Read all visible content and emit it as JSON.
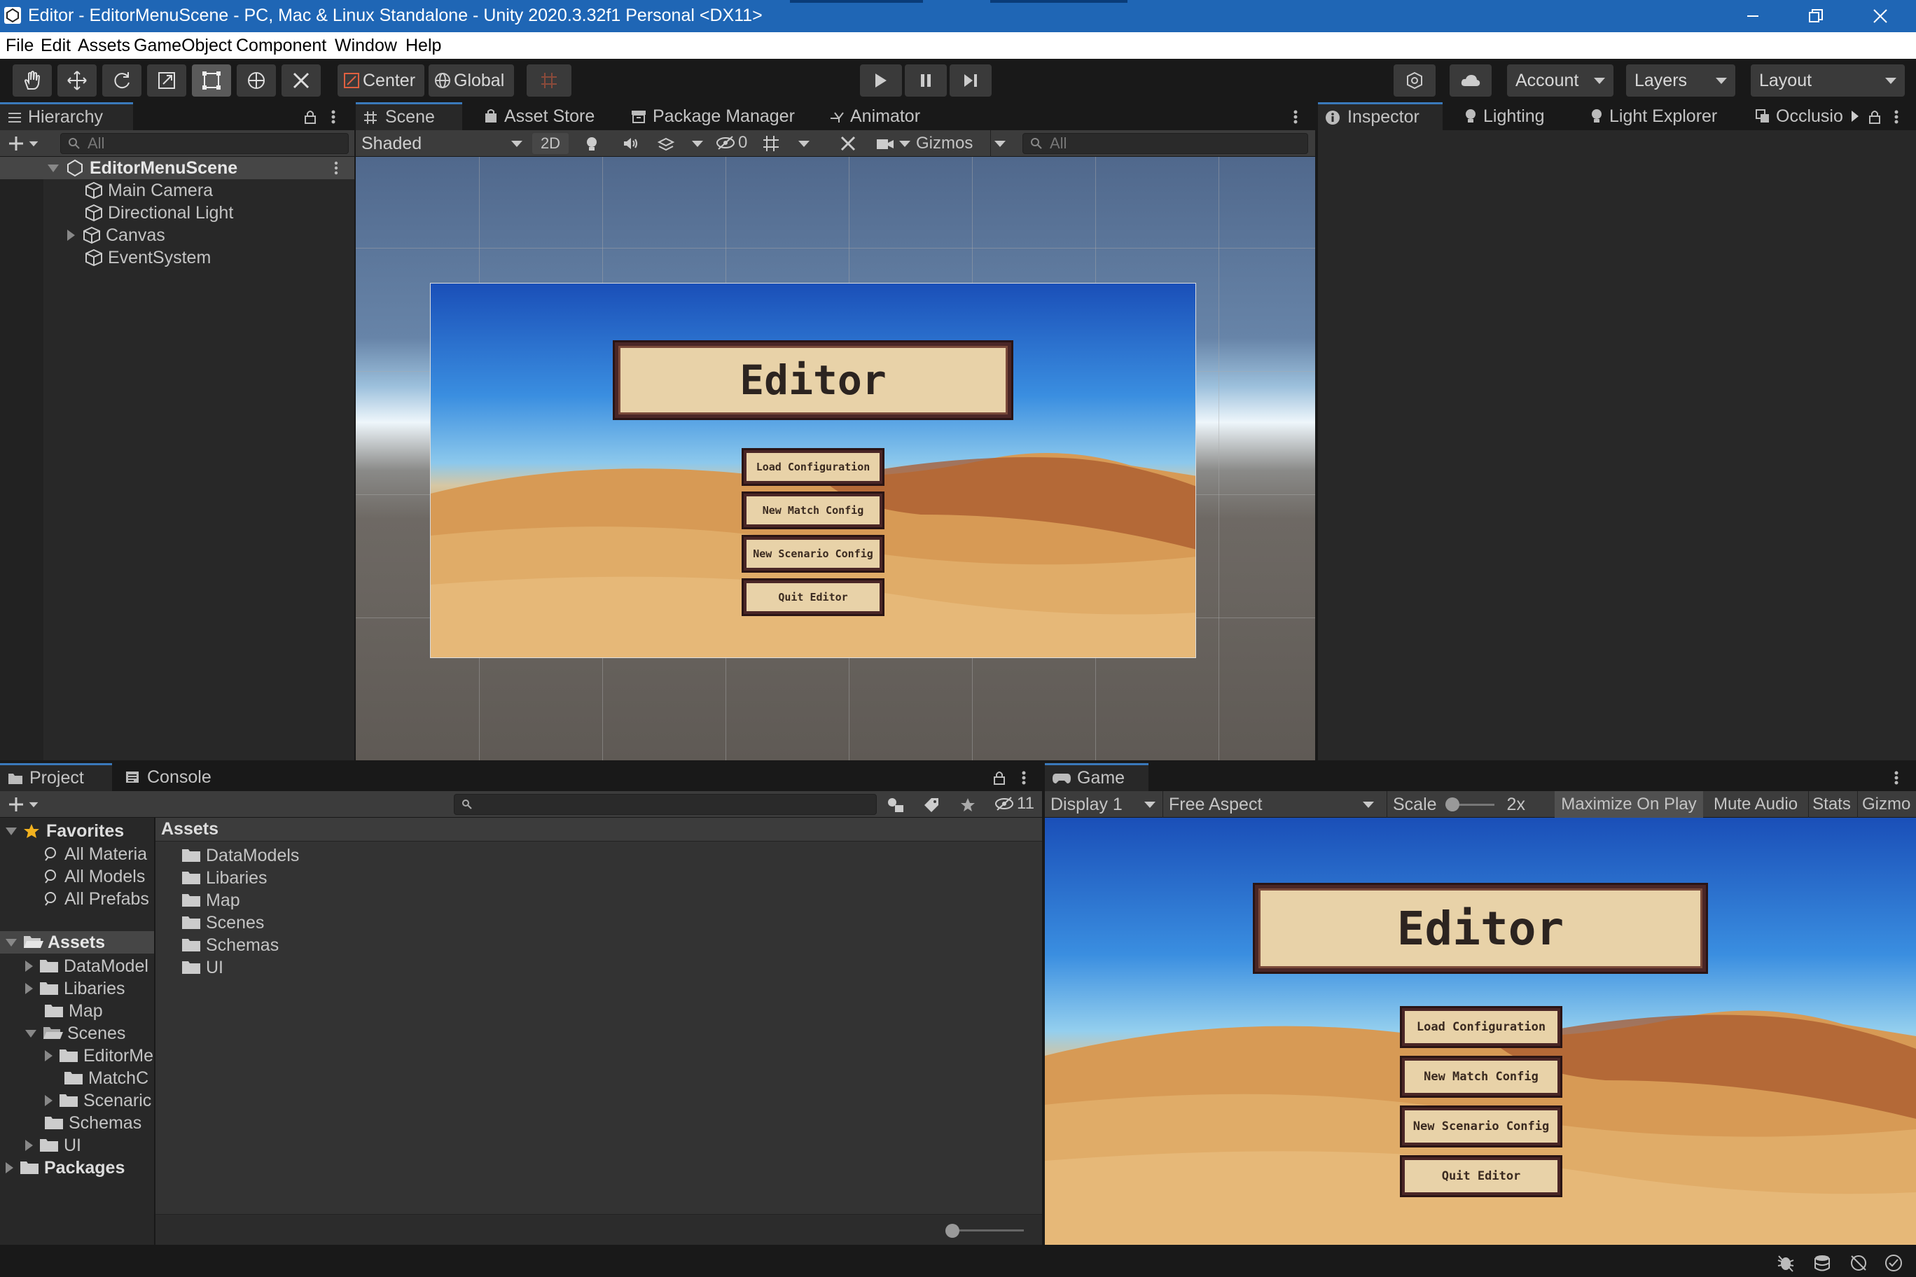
{
  "window": {
    "title": "Editor - EditorMenuScene - PC, Mac & Linux Standalone - Unity 2020.3.32f1 Personal <DX11>"
  },
  "menu": [
    "File",
    "Edit",
    "Assets",
    "GameObject",
    "Component",
    "Window",
    "Help"
  ],
  "toolbar": {
    "pivot": "Center",
    "space": "Global",
    "account": "Account",
    "layers": "Layers",
    "layout": "Layout"
  },
  "hierarchy": {
    "tab": "Hierarchy",
    "search_placeholder": "All",
    "scene": "EditorMenuScene",
    "items": [
      "Main Camera",
      "Directional Light",
      "Canvas",
      "EventSystem"
    ]
  },
  "scene_tabs": [
    "Scene",
    "Asset Store",
    "Package Manager",
    "Animator"
  ],
  "scene_toolbar": {
    "shading": "Shaded",
    "mode2d": "2D",
    "hidden_count": "0",
    "gizmos": "Gizmos",
    "search_placeholder": "All"
  },
  "inspector_tabs": [
    "Inspector",
    "Lighting",
    "Light Explorer",
    "Occlusio"
  ],
  "ui_menu": {
    "title": "Editor",
    "buttons": [
      "Load Configuration",
      "New Match Config",
      "New Scenario Config",
      "Quit Editor"
    ]
  },
  "project": {
    "tabs": [
      "Project",
      "Console"
    ],
    "hidden_count": "11",
    "favorites_label": "Favorites",
    "favorites": [
      "All Materia",
      "All Models",
      "All Prefabs"
    ],
    "assets_label": "Assets",
    "assets_tree": [
      "DataModel",
      "Libaries",
      "Map",
      "Scenes",
      "EditorMe",
      "MatchC",
      "Scenaric",
      "Schemas",
      "UI"
    ],
    "packages_label": "Packages",
    "breadcrumb": "Assets",
    "folders": [
      "DataModels",
      "Libaries",
      "Map",
      "Scenes",
      "Schemas",
      "UI"
    ]
  },
  "game": {
    "tab": "Game",
    "display": "Display 1",
    "aspect": "Free Aspect",
    "scale_label": "Scale",
    "scale_value": "2x",
    "maximize": "Maximize On Play",
    "mute": "Mute Audio",
    "stats": "Stats",
    "gizmos": "Gizmo"
  },
  "colors": {
    "accent": "#3a79bb",
    "titlebar": "#1f66b5",
    "button_fill": "#e8d2a8",
    "button_border": "#4a2626"
  }
}
